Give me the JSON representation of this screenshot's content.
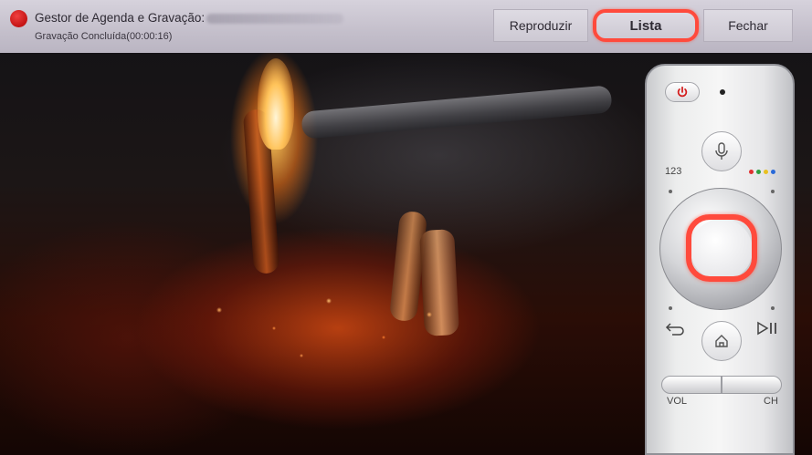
{
  "header": {
    "title": "Gestor de Agenda e Gravação:",
    "status": "Gravação Concluída(00:00:16)"
  },
  "buttons": {
    "play": "Reproduzir",
    "list": "Lista",
    "close": "Fechar"
  },
  "remote": {
    "number_label": "123",
    "volume_label": "VOL",
    "channel_label": "CH",
    "color_dots": [
      "#e03030",
      "#2ea040",
      "#e8c020",
      "#2a6ad8"
    ]
  },
  "colors": {
    "record": "#d41b1b",
    "highlight": "#ff4a3c"
  }
}
